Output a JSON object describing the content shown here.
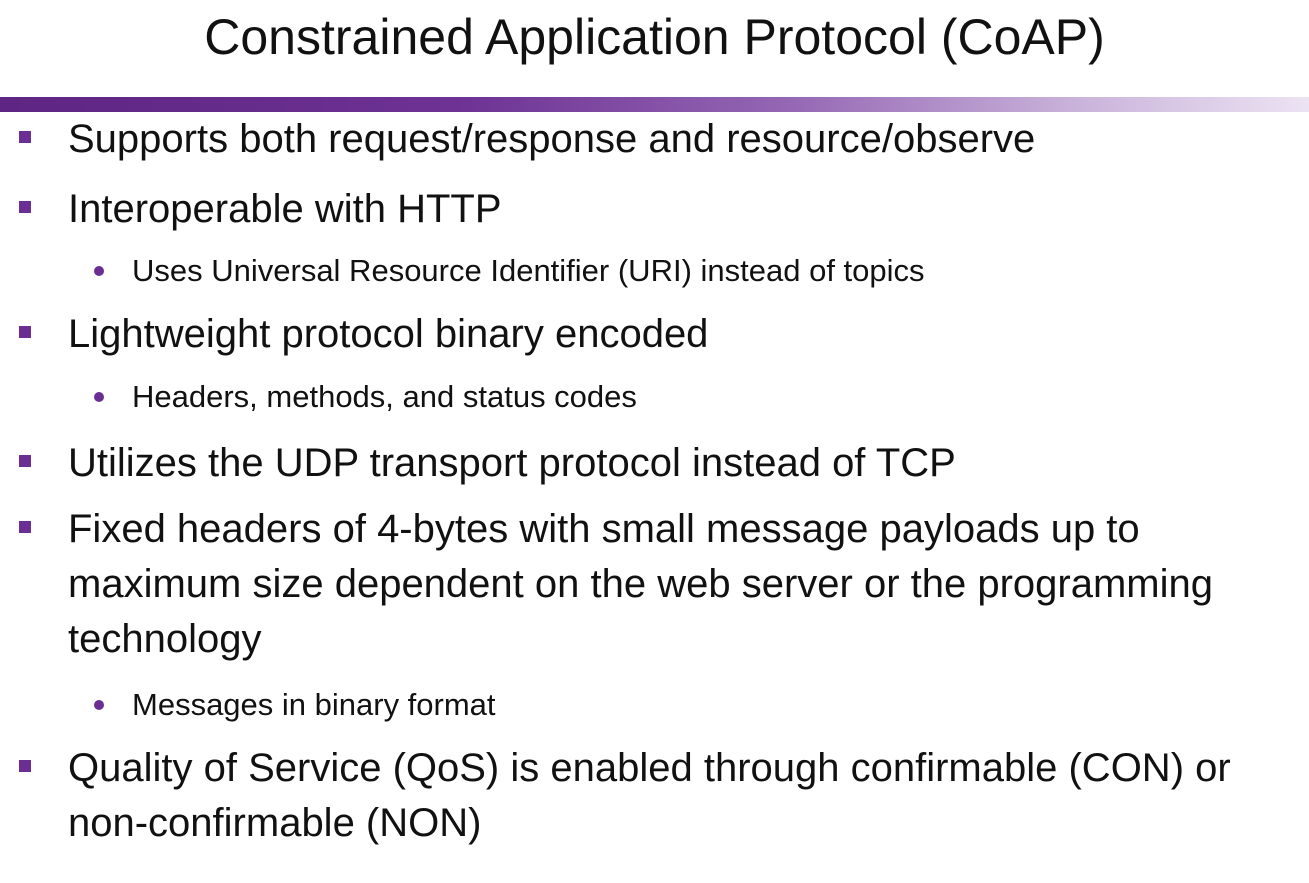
{
  "slide": {
    "title": "Constrained Application Protocol (CoAP)",
    "accent_color": "#6b2f93",
    "bullets": [
      {
        "level": 1,
        "text": "Supports both request/response and resource/observe"
      },
      {
        "level": 1,
        "text": "Interoperable with HTTP"
      },
      {
        "level": 2,
        "text": "Uses Universal Resource Identifier (URI) instead of topics"
      },
      {
        "level": 1,
        "text": "Lightweight protocol binary encoded"
      },
      {
        "level": 2,
        "text": "Headers, methods, and status codes"
      },
      {
        "level": 1,
        "text": "Utilizes the UDP transport protocol instead of TCP"
      },
      {
        "level": 1,
        "text": "Fixed headers of 4-bytes with small message payloads up to maximum size dependent on the web server or the programming technology"
      },
      {
        "level": 2,
        "text": "Messages in binary format"
      },
      {
        "level": 1,
        "text": "Quality of Service (QoS) is enabled through confirmable (CON) or non-confirmable (NON)"
      }
    ]
  }
}
